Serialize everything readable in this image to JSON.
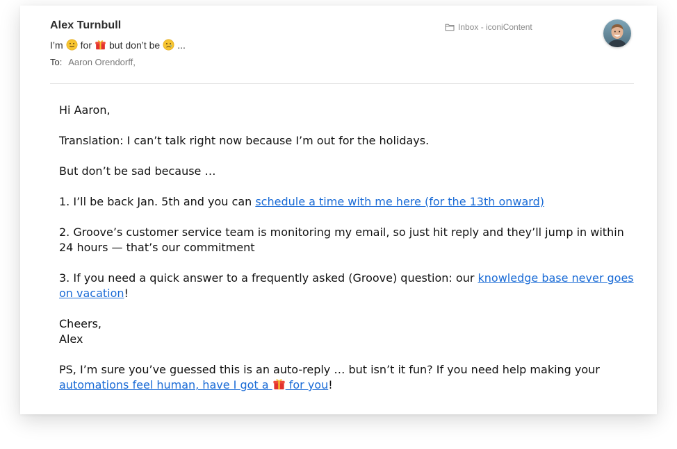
{
  "email": {
    "sender": "Alex Turnbull",
    "subject": {
      "prefix": "I’m",
      "emoji1": "slightly-smiling-face",
      "middle": "for",
      "emoji2": "wrapped-gift",
      "text2": "but don’t be",
      "emoji3": "crying-face",
      "suffix": "..."
    },
    "to_label": "To:",
    "to_value": "Aaron Orendorff,",
    "mailbox": "Inbox - iconiContent",
    "mailbox_icon": "folder-icon",
    "avatar_alt": "Alex Turnbull avatar"
  },
  "body": {
    "greeting": "Hi Aaron,",
    "translation": "Translation: I can’t talk right now because I’m out for the holidays.",
    "but": "But don’t be sad because …",
    "item1_text": "1. I’ll be back Jan. 5th and you can ",
    "item1_link": "schedule a time with me here (for the 13th onward)",
    "item2_text": "2. Groove’s customer service team is monitoring my email, so just hit reply and they’ll jump in within 24 hours — that’s our commitment",
    "item3_text": "3. If you need a quick answer to a frequently asked (Groove) question: our ",
    "item3_link": "knowledge base never goes on vacation",
    "item3_end": "!",
    "signoff": "Cheers,",
    "signature": "Alex",
    "ps_text": "PS, I’m sure you’ve guessed this is an auto-reply … but isn’t it fun? If you need help making your ",
    "ps_link_before": "automations feel human, have I got a ",
    "ps_link_after": " for you",
    "ps_end": "!"
  },
  "colors": {
    "link": "#1a6bd6",
    "text": "#111111",
    "muted": "#7a7a7a"
  }
}
